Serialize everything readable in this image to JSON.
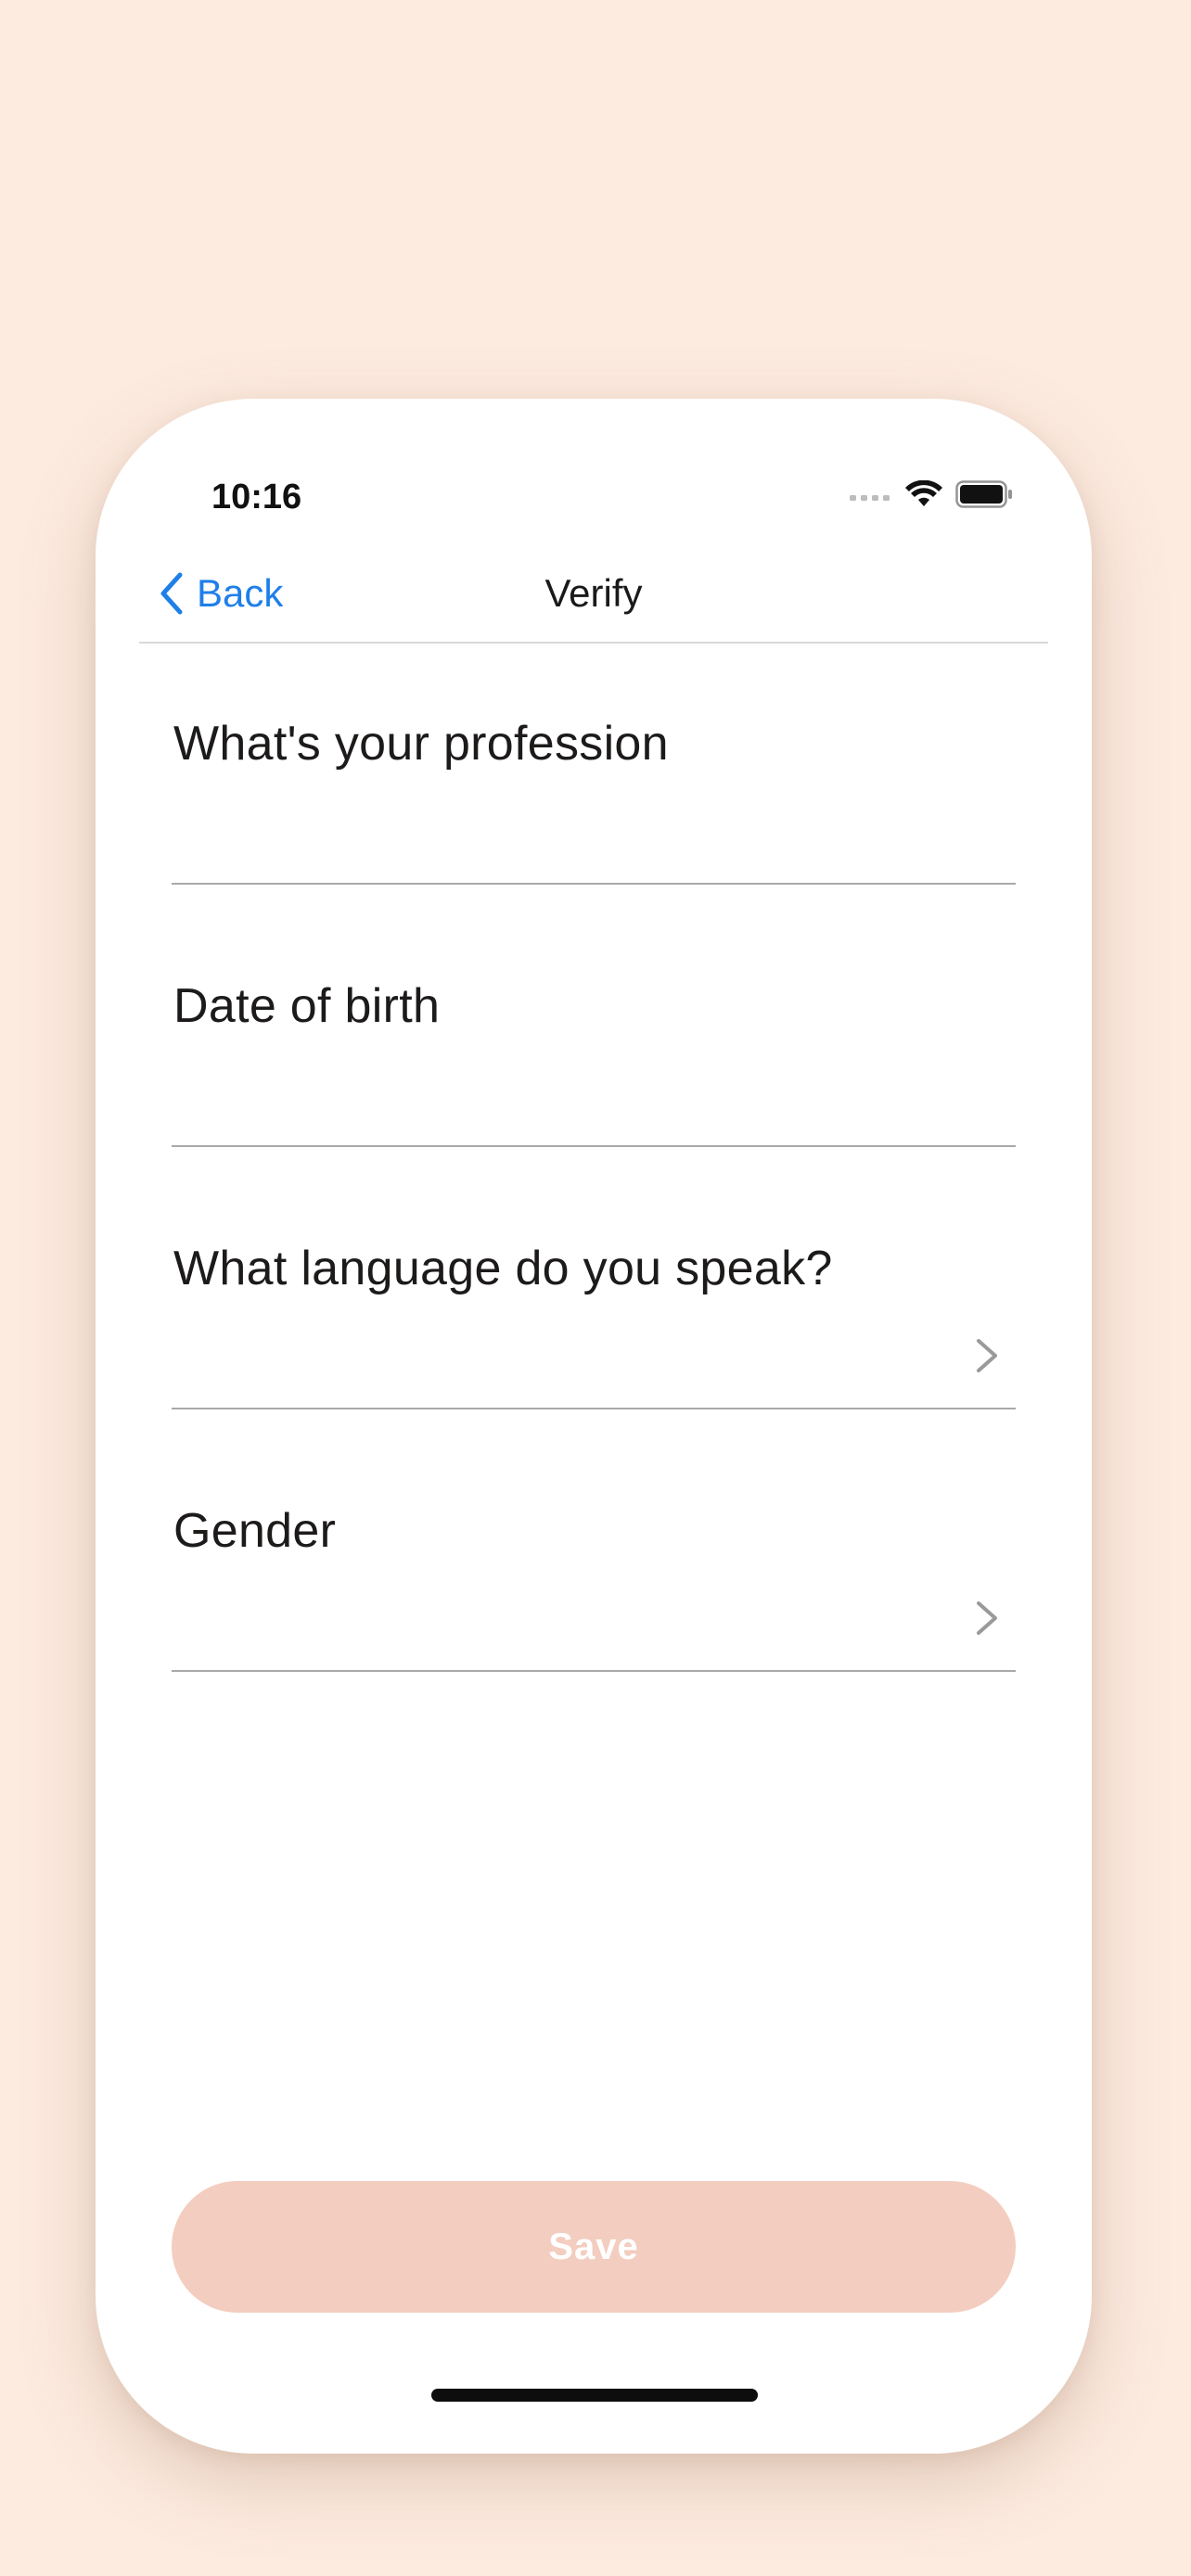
{
  "status_bar": {
    "time": "10:16",
    "icons": [
      "signal-icon",
      "wifi-icon",
      "battery-icon"
    ]
  },
  "nav": {
    "back_label": "Back",
    "title": "Verify"
  },
  "fields": [
    {
      "label": "What's your profession",
      "value": "",
      "has_chevron": false
    },
    {
      "label": "Date of birth",
      "value": "",
      "has_chevron": false
    },
    {
      "label": "What language do you speak?",
      "value": "",
      "has_chevron": true
    },
    {
      "label": "Gender",
      "value": "",
      "has_chevron": true
    }
  ],
  "save_button": {
    "label": "Save",
    "enabled": false
  },
  "colors": {
    "background": "#fdebe0",
    "accent": "#1f7fe8",
    "save_disabled": "#f3cdbf",
    "text": "#1d1a1a",
    "divider": "#a9a9a9"
  }
}
